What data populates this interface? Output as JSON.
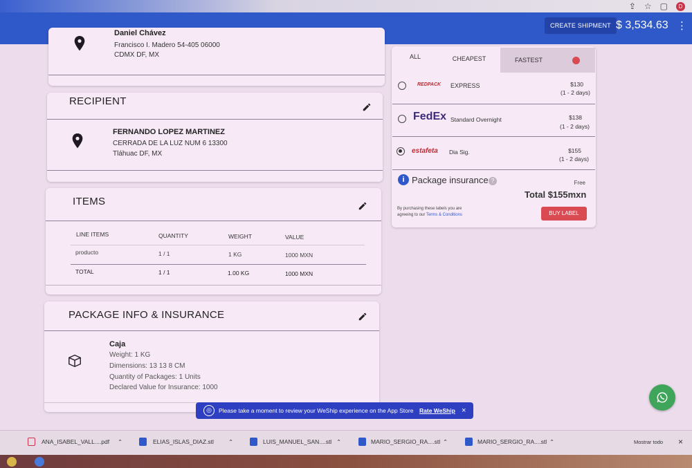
{
  "header": {
    "create_shipment": "CREATE SHIPMENT",
    "balance": "$ 3,534.63",
    "profile_initial": "D"
  },
  "sender": {
    "name": "Daniel Chávez",
    "line1": "Francisco I. Madero 54-405 06000",
    "line2": "CDMX DF, MX"
  },
  "recipient": {
    "title": "RECIPIENT",
    "name": "FERNANDO LOPEZ MARTINEZ",
    "line1": "CERRADA DE LA LUZ NUM 6 13300",
    "line2": "Tláhuac DF, MX"
  },
  "items": {
    "title": "ITEMS",
    "headers": [
      "LINE ITEMS",
      "QUANTITY",
      "WEIGHT",
      "VALUE"
    ],
    "rows": [
      [
        "producto",
        "1 / 1",
        "1 KG",
        "1000 MXN"
      ]
    ],
    "total": [
      "TOTAL",
      "1 / 1",
      "1.00 KG",
      "1000 MXN"
    ]
  },
  "package": {
    "title": "PACKAGE INFO & INSURANCE",
    "name": "Caja",
    "weight": "Weight: 1 KG",
    "dimensions": "Dimensions: 13 13 8 CM",
    "quantity": "Quantity of Packages: 1 Units",
    "declared": "Declared Value for Insurance: 1000"
  },
  "rates": {
    "tabs": [
      "ALL",
      "CHEAPEST",
      "FASTEST"
    ],
    "active_tab": "FASTEST",
    "options": [
      {
        "carrier": "REDPACK",
        "service": "EXPRESS",
        "price": "$130",
        "eta": "(1 - 2 days)",
        "selected": false
      },
      {
        "carrier": "FedEx",
        "service": "Standard Overnight",
        "price": "$138",
        "eta": "(1 - 2 days)",
        "selected": false
      },
      {
        "carrier": "estafeta",
        "service": "Dia Sig.",
        "price": "$155",
        "eta": "(1 - 2 days)",
        "selected": true
      }
    ],
    "insurance_label": "Package insurance",
    "insurance_help": "?",
    "insurance_value": "Free",
    "total": "Total $155mxn",
    "terms_line1": "By purchasing these labels you are",
    "terms_line2": "agreeing to our",
    "terms_link": "Terms & Conditions",
    "buy_label": "BUY LABEL"
  },
  "toast": {
    "message": "Please take a moment to review your WeShip experience on the App Store",
    "link": "Rate WeShip",
    "close": "×"
  },
  "downloads": {
    "files": [
      "ANA_ISABEL_VALL....pdf",
      "ELIAS_ISLAS_DIAZ.stl",
      "LUIS_MANUEL_SAN....stl",
      "MARIO_SERGIO_RA....stl",
      "MARIO_SERGIO_RA....stl"
    ],
    "show_all": "Mostrar todo",
    "close": "×"
  },
  "colors": {
    "brand_blue": "#2f58c9",
    "buy_red": "#d94a52",
    "whatsapp_green": "#3ea55a"
  }
}
